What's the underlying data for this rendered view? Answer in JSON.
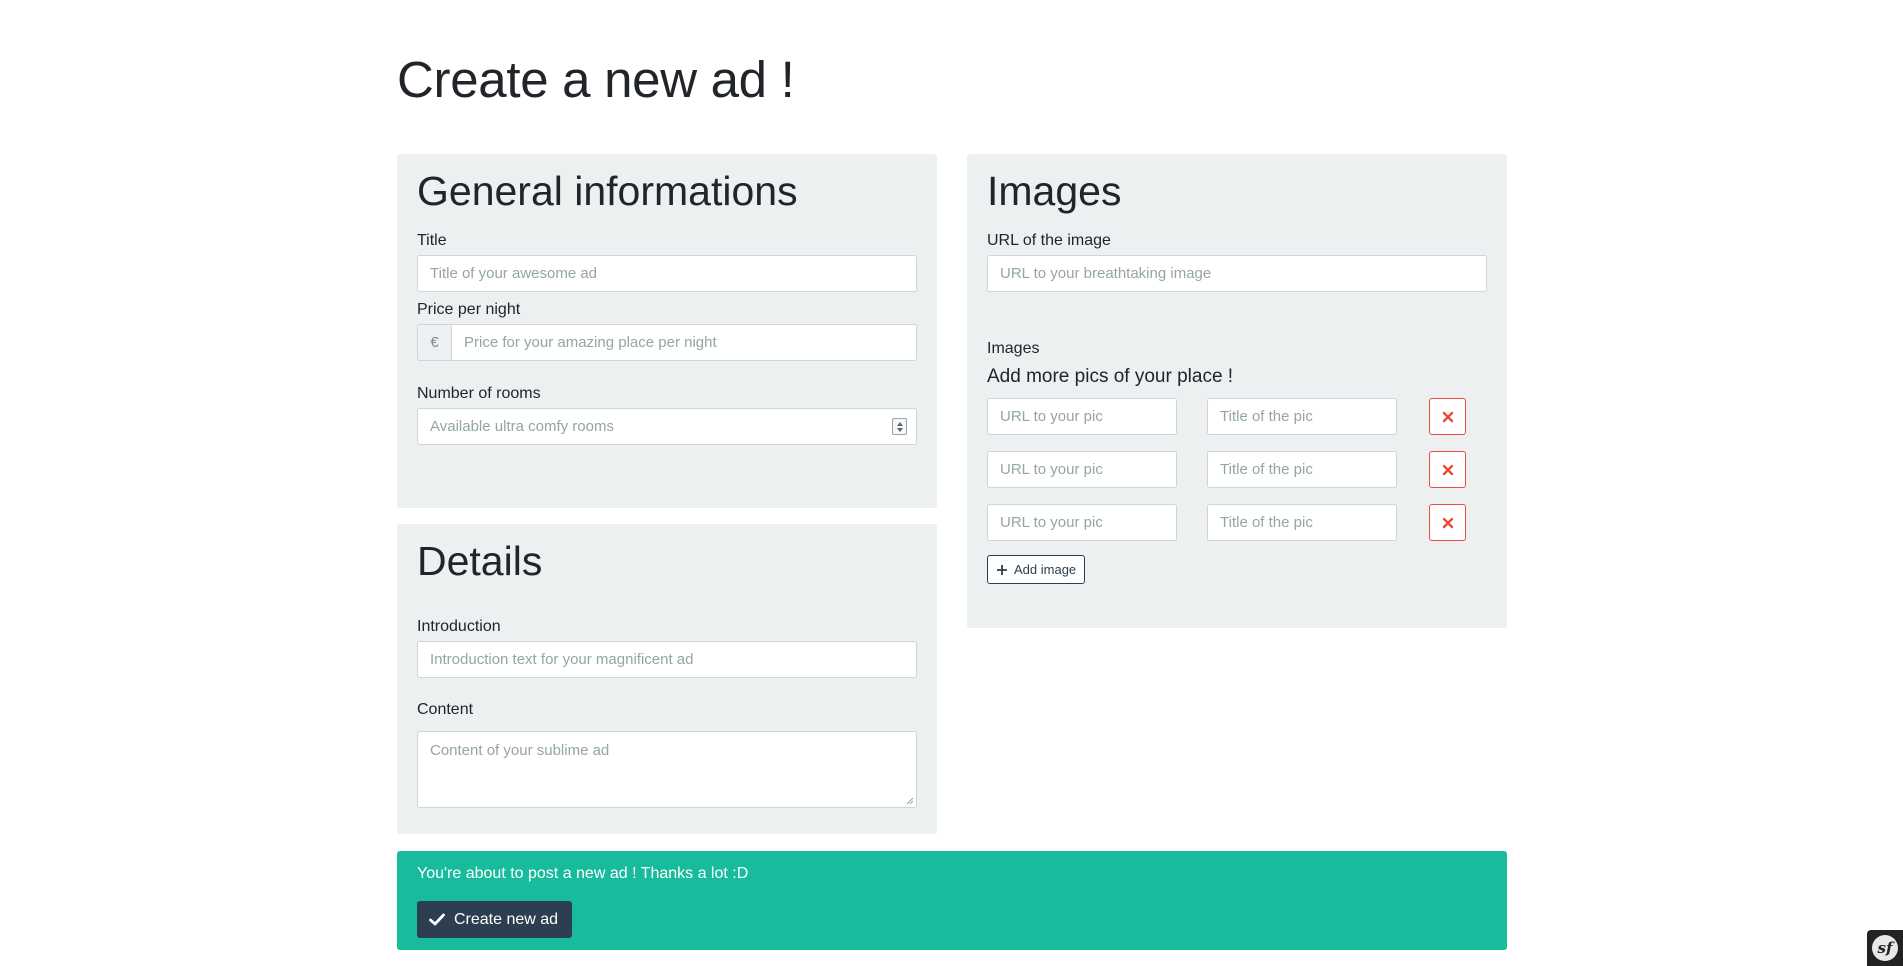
{
  "page": {
    "title": "Create a new ad !"
  },
  "general": {
    "heading": "General informations",
    "title_label": "Title",
    "title_placeholder": "Title of your awesome ad",
    "price_label": "Price per night",
    "price_addon": "€",
    "price_placeholder": "Price for your amazing place per night",
    "rooms_label": "Number of rooms",
    "rooms_placeholder": "Available ultra comfy rooms"
  },
  "details": {
    "heading": "Details",
    "intro_label": "Introduction",
    "intro_placeholder": "Introduction text for your magnificent ad",
    "content_label": "Content",
    "content_placeholder": "Content of your sublime ad"
  },
  "images": {
    "heading": "Images",
    "cover_label": "URL of the image",
    "cover_placeholder": "URL to your breathtaking image",
    "collection_label": "Images",
    "collection_title": "Add more pics of your place !",
    "rows": [
      {
        "url_placeholder": "URL to your pic",
        "title_placeholder": "Title of the pic"
      },
      {
        "url_placeholder": "URL to your pic",
        "title_placeholder": "Title of the pic"
      },
      {
        "url_placeholder": "URL to your pic",
        "title_placeholder": "Title of the pic"
      }
    ],
    "add_button": "Add image"
  },
  "alert": {
    "message": "You're about to post a new ad ! Thanks a lot :D",
    "submit_label": "Create new ad"
  },
  "toolbar": {
    "logo": "sf"
  },
  "icons": {
    "delete": "close-icon",
    "add": "plus-icon",
    "submit": "check-icon",
    "toolbar": "symfony-logo"
  },
  "colors": {
    "panel_bg": "#ecf0f1",
    "primary": "#2c3e50",
    "success": "#18bc9c",
    "danger": "#e74c3c"
  }
}
